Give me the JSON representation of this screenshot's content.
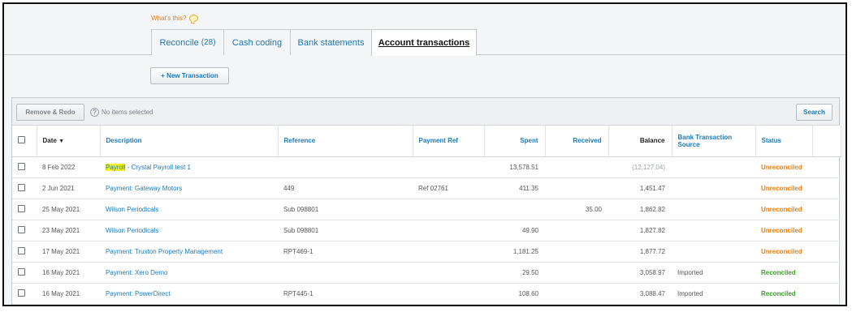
{
  "page": {
    "whats_this": "What's this?"
  },
  "tabs": [
    {
      "label": "Reconcile",
      "count": "(28)"
    },
    {
      "label": "Cash coding"
    },
    {
      "label": "Bank statements"
    },
    {
      "label": "Account transactions"
    }
  ],
  "toolbar": {
    "new_transaction": "+ New Transaction",
    "remove_redo": "Remove & Redo",
    "help": "?",
    "no_items": "No items selected",
    "search": "Search"
  },
  "table": {
    "headers": {
      "date": "Date",
      "date_sort": "▼",
      "description": "Description",
      "reference": "Reference",
      "payment_ref": "Payment Ref",
      "spent": "Spent",
      "received": "Received",
      "balance": "Balance",
      "source": "Bank Transaction Source",
      "status": "Status"
    },
    "rows": [
      {
        "date": "8 Feb 2022",
        "desc_highlight": "Payroll",
        "desc_rest": " - Crystal Payroll test 1",
        "reference": "",
        "payment_ref": "",
        "spent": "13,578.51",
        "received": "",
        "balance": "(12,127.04)",
        "source": "",
        "status": "Unreconciled"
      },
      {
        "date": "2 Jun 2021",
        "desc_highlight": "",
        "desc_rest": "Payment: Gateway Motors",
        "reference": "449",
        "payment_ref": "Ref 02761",
        "spent": "411.35",
        "received": "",
        "balance": "1,451.47",
        "source": "",
        "status": "Unreconciled"
      },
      {
        "date": "25 May 2021",
        "desc_highlight": "",
        "desc_rest": "Wilson Periodicals",
        "reference": "Sub 098801",
        "payment_ref": "",
        "spent": "",
        "received": "35.00",
        "balance": "1,862.82",
        "source": "",
        "status": "Unreconciled"
      },
      {
        "date": "23 May 2021",
        "desc_highlight": "",
        "desc_rest": "Wilson Periodicals",
        "reference": "Sub 098801",
        "payment_ref": "",
        "spent": "49.90",
        "received": "",
        "balance": "1,827.82",
        "source": "",
        "status": "Unreconciled"
      },
      {
        "date": "17 May 2021",
        "desc_highlight": "",
        "desc_rest": "Payment: Truxton Property Management",
        "reference": "RPT469-1",
        "payment_ref": "",
        "spent": "1,181.25",
        "received": "",
        "balance": "1,877.72",
        "source": "",
        "status": "Unreconciled"
      },
      {
        "date": "16 May 2021",
        "desc_highlight": "",
        "desc_rest": "Payment: Xero Demo",
        "reference": "",
        "payment_ref": "",
        "spent": "29.50",
        "received": "",
        "balance": "3,058.97",
        "source": "Imported",
        "status": "Reconciled"
      },
      {
        "date": "16 May 2021",
        "desc_highlight": "",
        "desc_rest": "Payment: PowerDirect",
        "reference": "RPT445-1",
        "payment_ref": "",
        "spent": "108.60",
        "received": "",
        "balance": "3,088.47",
        "source": "Imported",
        "status": "Reconciled"
      }
    ]
  },
  "colors": {
    "link": "#1c79b6",
    "unreconciled": "#ea7e11",
    "reconciled": "#3c9b2b",
    "highlight": "#f6f11d"
  }
}
